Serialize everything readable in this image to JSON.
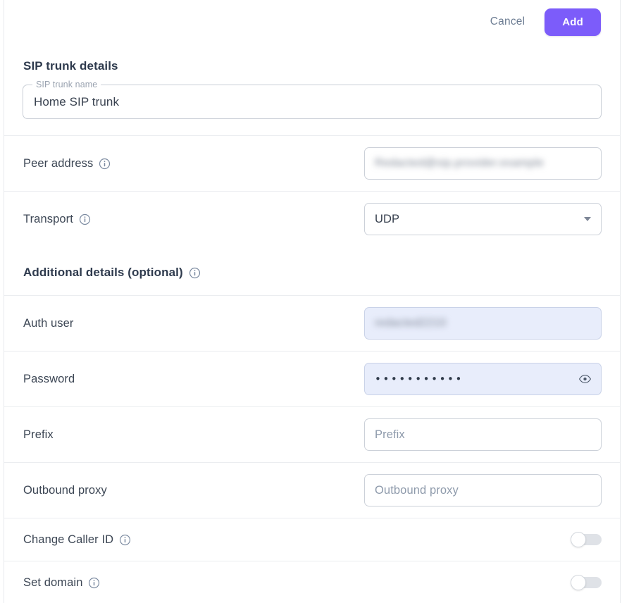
{
  "header": {
    "cancel_label": "Cancel",
    "add_label": "Add"
  },
  "sections": {
    "sip": {
      "title": "SIP trunk details",
      "name_field": {
        "legend": "SIP trunk name",
        "value": "Home SIP trunk"
      },
      "rows": [
        {
          "label": "Peer address",
          "has_info": true,
          "value": "Redacted@sip.provider.example",
          "redacted": true,
          "type": "text"
        },
        {
          "label": "Transport",
          "has_info": true,
          "value": "UDP",
          "type": "select"
        }
      ]
    },
    "additional": {
      "title": "Additional details (optional)",
      "has_info": true,
      "rows": [
        {
          "label": "Auth user",
          "has_info": false,
          "value": "redacted2210",
          "redacted": true,
          "autofill": true,
          "type": "text"
        },
        {
          "label": "Password",
          "has_info": false,
          "value": "•••••••••••",
          "autofill": true,
          "type": "password",
          "reveal_icon": "eye-icon"
        },
        {
          "label": "Prefix",
          "has_info": false,
          "placeholder": "Prefix",
          "value": "",
          "type": "text"
        },
        {
          "label": "Outbound proxy",
          "has_info": false,
          "placeholder": "Outbound proxy",
          "value": "",
          "type": "text"
        },
        {
          "label": "Change Caller ID",
          "has_info": true,
          "type": "toggle",
          "enabled": false
        },
        {
          "label": "Set domain",
          "has_info": true,
          "type": "toggle",
          "enabled": false
        }
      ]
    }
  },
  "colors": {
    "accent": "#7c5cfa",
    "cancel_text": "#6d7d93",
    "autofill_bg": "#e8edfb",
    "info_icon": "#7b8aa0",
    "divider": "#ebedf0"
  }
}
